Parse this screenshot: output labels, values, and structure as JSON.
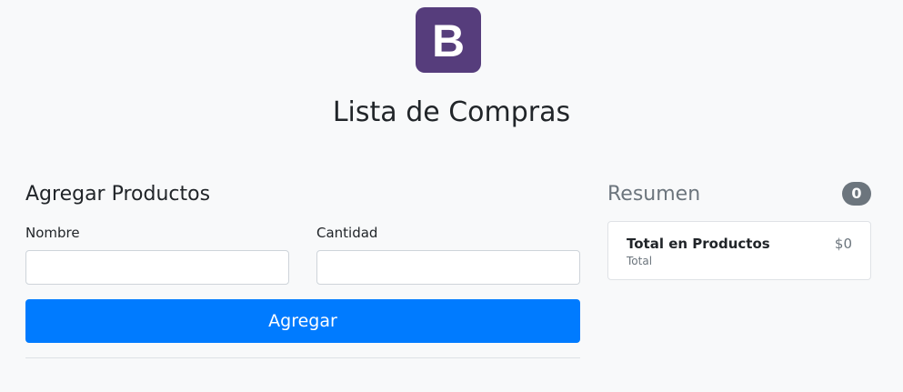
{
  "logo": {
    "letter": "B",
    "color": "#563d7c"
  },
  "page_title": "Lista de Compras",
  "form": {
    "title": "Agregar Productos",
    "nombre_label": "Nombre",
    "nombre_value": "",
    "cantidad_label": "Cantidad",
    "cantidad_value": "",
    "submit_label": "Agregar",
    "submit_color": "#007bff"
  },
  "summary": {
    "title": "Resumen",
    "count": "0",
    "item_title": "Total en Productos",
    "item_subtitle": "Total",
    "item_value": "$0"
  }
}
